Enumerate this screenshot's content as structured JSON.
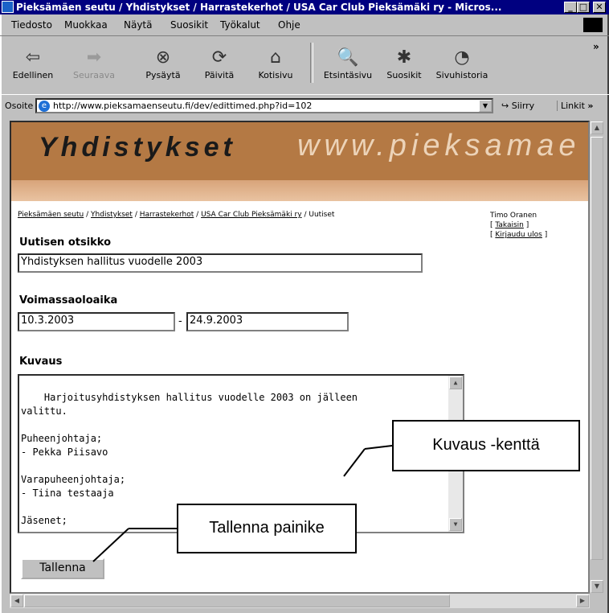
{
  "window": {
    "title": "Pieksämäen seutu / Yhdistykset / Harrastekerhot / USA Car Club Pieksämäki ry - Micros...",
    "controls": [
      "minimize",
      "maximize",
      "close"
    ]
  },
  "menu": {
    "items": [
      "Tiedosto",
      "Muokkaa",
      "Näytä",
      "Suosikit",
      "Työkalut",
      "Ohje"
    ]
  },
  "toolbar": {
    "buttons": [
      {
        "label": "Edellinen",
        "icon": "back-arrow-icon",
        "glyph": "⇦"
      },
      {
        "label": "Seuraava",
        "icon": "forward-arrow-icon",
        "glyph": "➡"
      },
      {
        "label": "Pysäytä",
        "icon": "stop-icon",
        "glyph": "⊗"
      },
      {
        "label": "Päivitä",
        "icon": "refresh-icon",
        "glyph": "⟳"
      },
      {
        "label": "Kotisivu",
        "icon": "home-icon",
        "glyph": "⌂"
      },
      {
        "label": "Etsintäsivu",
        "icon": "search-icon",
        "glyph": "🔍"
      },
      {
        "label": "Suosikit",
        "icon": "favorites-icon",
        "glyph": "✱"
      },
      {
        "label": "Sivuhistoria",
        "icon": "history-icon",
        "glyph": "◔"
      }
    ],
    "more": "»"
  },
  "address": {
    "label": "Osoite",
    "url": "http://www.pieksamaenseutu.fi/dev/edittimed.php?id=102",
    "go_label": "Siirry",
    "links_label": "Linkit"
  },
  "banner": {
    "title": "Yhdistykset",
    "url_text": "www.pieksamae"
  },
  "breadcrumb": {
    "items": [
      "Pieksämäen seutu",
      "Yhdistykset",
      "Harrastekerhot",
      "USA Car Club Pieksämäki ry"
    ],
    "current": "Uutiset",
    "separator": "/"
  },
  "user": {
    "name": "Timo Oranen",
    "back_link": "Takaisin",
    "logout_link": "Kirjaudu ulos"
  },
  "form": {
    "title_label": "Uutisen otsikko",
    "title_value": "Yhdistyksen hallitus vuodelle 2003",
    "validity_label": "Voimassaoloaika",
    "start_date": "10.3.2003",
    "date_separator": "-",
    "end_date": "24.9.2003",
    "description_label": "Kuvaus",
    "description_value": "Harjoitusyhdistyksen hallitus vuodelle 2003 on jälleen\nvalittu.\n\nPuheenjohtaja;\n- Pekka Piisavo\n\nVarapuheenjohtaja;\n- Tiina testaaja\n\nJäsenet;",
    "save_label": "Tallenna"
  },
  "callouts": {
    "description_field": "Kuvaus -kenttä",
    "save_button": "Tallenna painike"
  },
  "colors": {
    "titlebar": "#000080",
    "banner": "#b47944",
    "banner_strip": "#e3b892"
  }
}
